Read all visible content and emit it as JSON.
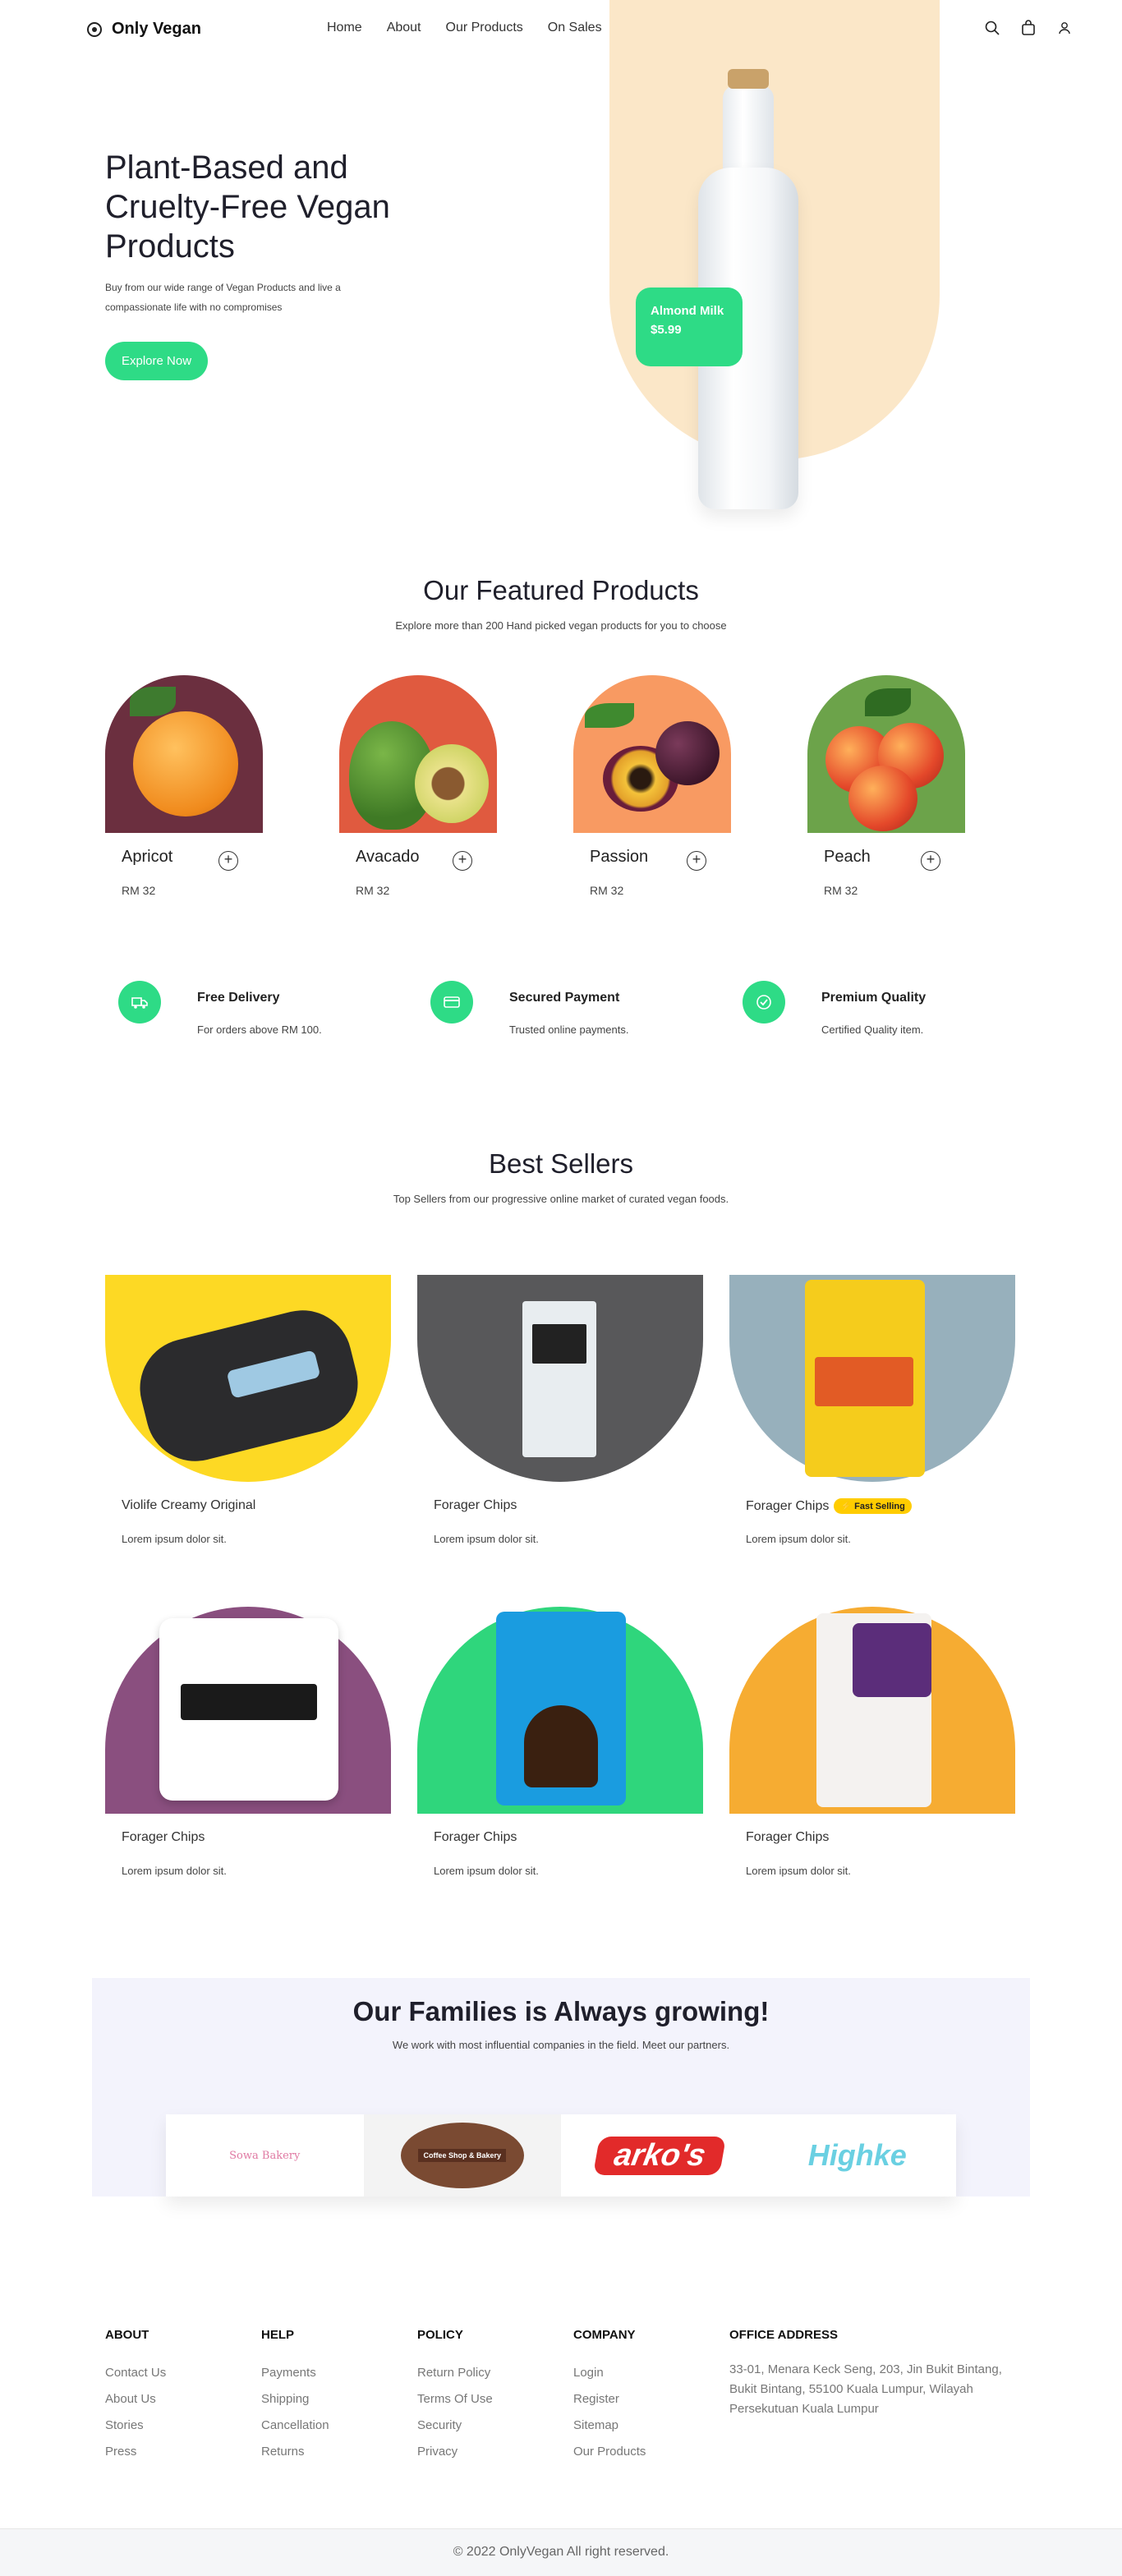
{
  "brand": {
    "name": "Only Vegan"
  },
  "nav": {
    "items": [
      "Home",
      "About",
      "Our Products",
      "On Sales"
    ]
  },
  "hero": {
    "title": "Plant-Based and Cruelty-Free Vegan Products",
    "subtitle": "Buy from our wide range of Vegan Products and live a compassionate life with no compromises",
    "cta": "Explore Now",
    "tag_name": "Almond Milk",
    "tag_price": "$5.99"
  },
  "featured": {
    "title": "Our Featured Products",
    "subtitle": "Explore more than 200 Hand picked vegan products for you to choose",
    "items": [
      {
        "name": "Apricot",
        "price": "RM 32",
        "bg": "#6b2f3f"
      },
      {
        "name": "Avacado",
        "price": "RM 32",
        "bg": "#e05a3f"
      },
      {
        "name": "Passion",
        "price": "RM 32",
        "bg": "#f89a62"
      },
      {
        "name": "Peach",
        "price": "RM 32",
        "bg": "#6ca34a"
      }
    ]
  },
  "features": [
    {
      "title": "Free Delivery",
      "sub": "For orders above RM 100.",
      "icon": "truck-icon"
    },
    {
      "title": "Secured Payment",
      "sub": "Trusted online payments.",
      "icon": "card-icon"
    },
    {
      "title": "Premium Quality",
      "sub": "Certified Quality item.",
      "icon": "check-icon"
    }
  ],
  "best": {
    "title": "Best Sellers",
    "subtitle": "Top Sellers from our progressive online market of curated vegan foods.",
    "items": [
      {
        "name": "Violife Creamy Original",
        "desc": "Lorem ipsum dolor sit.",
        "bg": "#fdd924",
        "badge": ""
      },
      {
        "name": "Forager Chips",
        "desc": "Lorem ipsum dolor sit.",
        "bg": "#58585a",
        "badge": ""
      },
      {
        "name": "Forager Chips",
        "desc": "Lorem ipsum dolor sit.",
        "bg": "#97b0bc",
        "badge": "Fast Selling"
      },
      {
        "name": "Forager Chips",
        "desc": "Lorem ipsum dolor sit.",
        "bg": "#8a4f7f",
        "badge": ""
      },
      {
        "name": "Forager Chips",
        "desc": "Lorem ipsum dolor sit.",
        "bg": "#2fd67c",
        "badge": ""
      },
      {
        "name": "Forager Chips",
        "desc": "Lorem ipsum dolor sit.",
        "bg": "#f6ac32",
        "badge": ""
      }
    ]
  },
  "families": {
    "title": "Our Families is Always growing!",
    "subtitle": "We work with most influential companies in the field. Meet our partners.",
    "partners": [
      "Sowa Bakery",
      "Coffee Shop & Bakery",
      "arko's",
      "Highke"
    ]
  },
  "footer": {
    "about": {
      "title": "ABOUT",
      "items": [
        "Contact Us",
        "About Us",
        "Stories",
        "Press"
      ]
    },
    "help": {
      "title": "HELP",
      "items": [
        "Payments",
        "Shipping",
        "Cancellation",
        "Returns"
      ]
    },
    "policy": {
      "title": "POLICY",
      "items": [
        "Return Policy",
        "Terms Of Use",
        "Security",
        "Privacy"
      ]
    },
    "company": {
      "title": "COMPANY",
      "items": [
        "Login",
        "Register",
        "Sitemap",
        "Our Products"
      ]
    },
    "office": {
      "title": "OFFICE ADDRESS",
      "address": "33-01, Menara Keck Seng, 203, Jin Bukit Bintang, Bukit Bintang, 55100 Kuala Lumpur, Wilayah Persekutuan Kuala Lumpur"
    },
    "copyright": "© 2022 OnlyVegan All right reserved."
  },
  "colors": {
    "accent": "#2edb86",
    "hero_bg": "#fbe7c8",
    "badge": "#ffcc00"
  }
}
